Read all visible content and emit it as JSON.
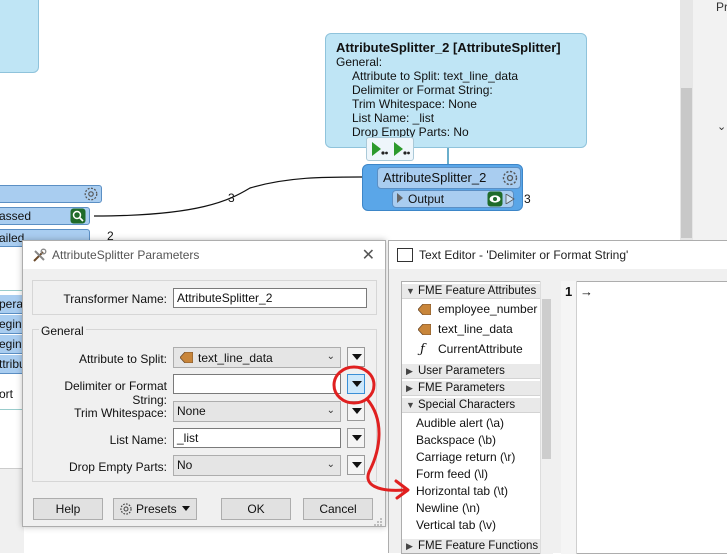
{
  "canvas": {
    "right_panel_text": "Pr",
    "tooltip": {
      "title": "AttributeSplitter_2 [AttributeSplitter]",
      "section": "General:",
      "lines": [
        "Attribute to Split: text_line_data",
        "Delimiter or Format String:",
        "Trim Whitespace: None",
        "List Name: _list",
        "Drop Empty Parts: No"
      ]
    },
    "node": {
      "name": "AttributeSplitter_2",
      "output_port": "Output",
      "output_count": "3"
    },
    "left_node": {
      "rows": [
        "",
        "assed",
        "ailed"
      ]
    },
    "connection_counts": [
      "3",
      "2"
    ],
    "left_list_items": [
      "perat",
      "egins",
      "egins",
      "ttribu",
      "ort"
    ]
  },
  "params_dialog": {
    "title": "AttributeSplitter Parameters",
    "close": "✕",
    "transformer_name_label": "Transformer Name:",
    "transformer_name_value": "AttributeSplitter_2",
    "general_legend": "General",
    "fields": {
      "attr_to_split_label": "Attribute to Split:",
      "attr_to_split_value": "text_line_data",
      "delimiter_label": "Delimiter or Format String:",
      "delimiter_value": "",
      "trim_label": "Trim Whitespace:",
      "trim_value": "None",
      "list_name_label": "List Name:",
      "list_name_value": "_list",
      "drop_empty_label": "Drop Empty Parts:",
      "drop_empty_value": "No"
    },
    "buttons": {
      "help": "Help",
      "presets": "Presets",
      "ok": "OK",
      "cancel": "Cancel"
    }
  },
  "text_editor": {
    "title": "Text Editor - 'Delimiter or Format String'",
    "categories": {
      "feature_attributes": "FME Feature Attributes",
      "user_parameters": "User Parameters",
      "fme_parameters": "FME Parameters",
      "special_characters": "Special Characters",
      "feature_functions": "FME Feature Functions"
    },
    "attributes": [
      "employee_number",
      "text_line_data",
      "CurrentAttribute"
    ],
    "special_characters": [
      "Audible alert (\\a)",
      "Backspace (\\b)",
      "Carriage return (\\r)",
      "Form feed (\\l)",
      "Horizontal tab (\\t)",
      "Newline (\\n)",
      "Vertical tab (\\v)"
    ],
    "editor": {
      "line_number": "1",
      "content": "→"
    }
  },
  "colors": {
    "node_blue": "#5aa6e8",
    "tooltip_blue": "#bfe5f5",
    "annotation_red": "#e02020"
  }
}
